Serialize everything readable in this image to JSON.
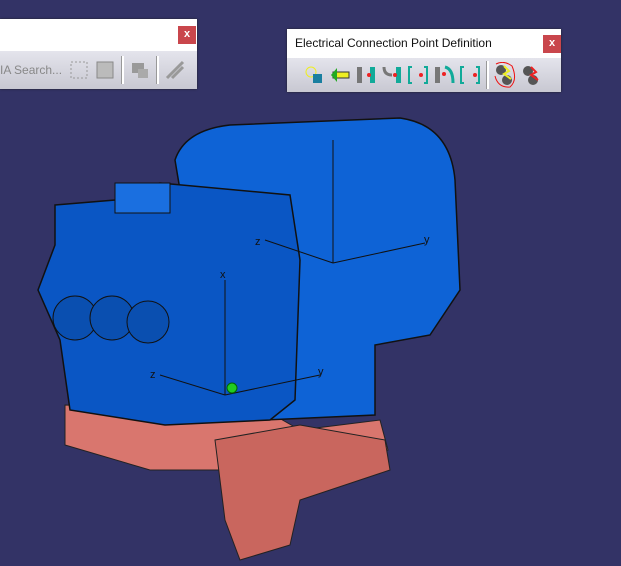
{
  "left_toolbar": {
    "search_placeholder": "IA Search...",
    "close_label": "x"
  },
  "right_toolbar": {
    "title": "Electrical Connection Point Definition",
    "close_label": "x",
    "icons": [
      "connection-point-icon",
      "arrow-insert-icon",
      "cavity-connection-icon",
      "bundle-connection-icon",
      "bracket-connection-icon",
      "shell-connection-icon",
      "bracket-point-icon",
      "define-connection-highlighted-icon",
      "define-connection-alt-icon"
    ]
  },
  "colors": {
    "background": "#333366",
    "body_blue": "#0e63d6",
    "pink": "#d9766e",
    "annotation": "#ee1111"
  },
  "axes": {
    "x": "x",
    "y": "y",
    "z": "z"
  }
}
